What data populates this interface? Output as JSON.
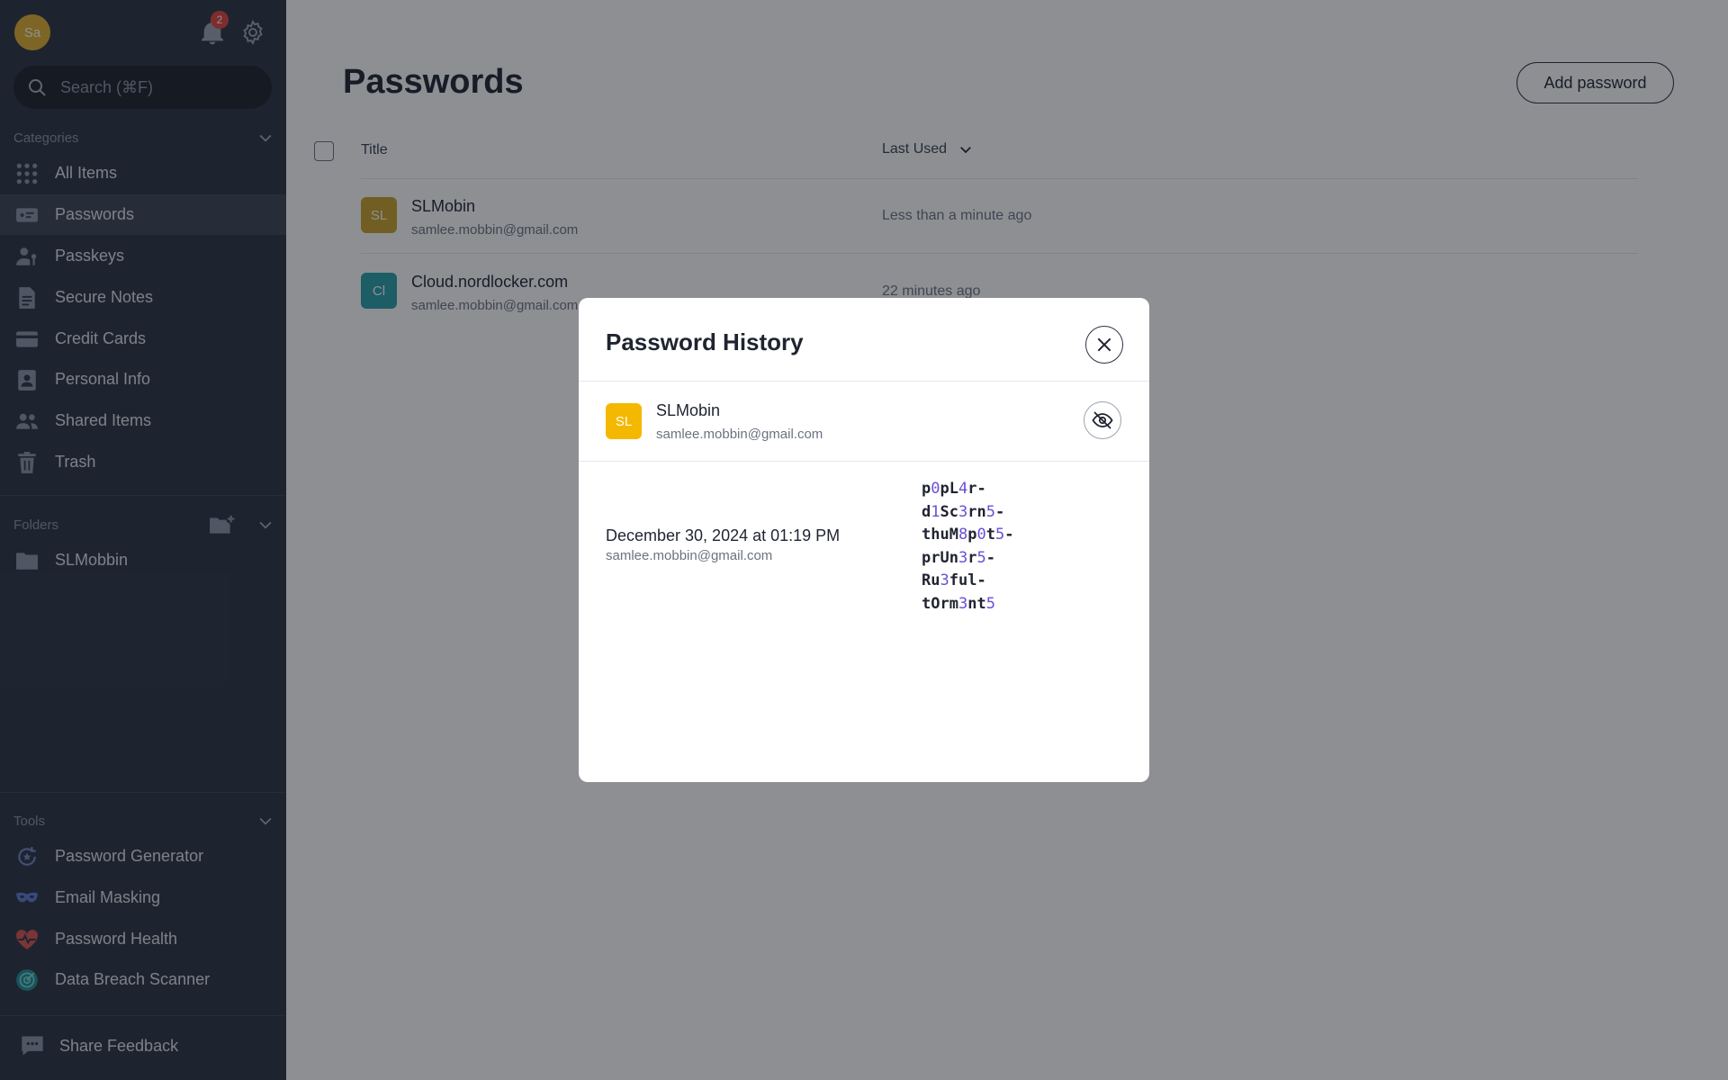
{
  "sidebar": {
    "avatar_initials": "Sa",
    "notification_count": "2",
    "search_placeholder": "Search (⌘F)",
    "categories_label": "Categories",
    "items": [
      {
        "label": "All Items",
        "icon": "grid-icon"
      },
      {
        "label": "Passwords",
        "icon": "password-icon"
      },
      {
        "label": "Passkeys",
        "icon": "passkey-icon"
      },
      {
        "label": "Secure Notes",
        "icon": "note-icon"
      },
      {
        "label": "Credit Cards",
        "icon": "credit-card-icon"
      },
      {
        "label": "Personal Info",
        "icon": "personal-info-icon"
      },
      {
        "label": "Shared Items",
        "icon": "shared-icon"
      },
      {
        "label": "Trash",
        "icon": "trash-icon"
      }
    ],
    "folders_label": "Folders",
    "folders": [
      {
        "label": "SLMobbin"
      }
    ],
    "tools_label": "Tools",
    "tools": [
      {
        "label": "Password Generator",
        "icon": "password-generator-icon"
      },
      {
        "label": "Email Masking",
        "icon": "mask-icon"
      },
      {
        "label": "Password Health",
        "icon": "heart-icon"
      },
      {
        "label": "Data Breach Scanner",
        "icon": "radar-icon"
      }
    ],
    "feedback_label": "Share Feedback"
  },
  "main": {
    "title": "Passwords",
    "add_button": "Add password",
    "columns": {
      "title": "Title",
      "last_used": "Last Used"
    },
    "rows": [
      {
        "initials": "SL",
        "title": "SLMobin",
        "email": "samlee.mobbin@gmail.com",
        "last_used": "Less than a minute ago",
        "color": "#c9a227"
      },
      {
        "initials": "Cl",
        "title": "Cloud.nordlocker.com",
        "email": "samlee.mobbin@gmail.com",
        "last_used": "22 minutes ago",
        "color": "#2a9fa8"
      }
    ]
  },
  "modal": {
    "title": "Password History",
    "item": {
      "initials": "SL",
      "title": "SLMobin",
      "email": "samlee.mobbin@gmail.com",
      "color": "#f5b800"
    },
    "history": [
      {
        "date": "December 30, 2024 at 01:19 PM",
        "email": "samlee.mobbin@gmail.com",
        "password_lines": [
          "p0pL4r-",
          "d1Sc3rn5-",
          "thuM8p0t5-",
          "prUn3r5-",
          "Ru3ful-",
          "tOrm3nt5"
        ]
      }
    ]
  },
  "colors": {
    "sidebar_bg": "#2b3240",
    "accent_digit": "#6b4fd8",
    "badge_red": "#e0443e"
  }
}
